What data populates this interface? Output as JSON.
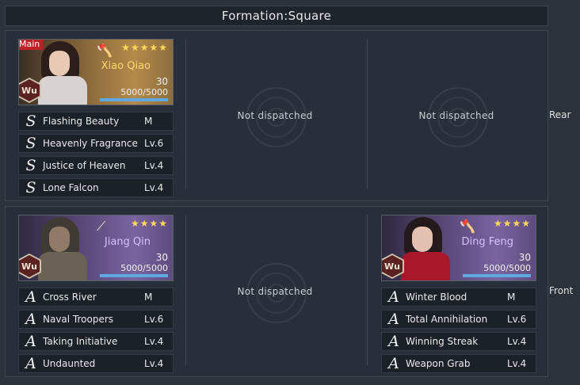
{
  "title": "Formation:Square",
  "rows": {
    "rear": {
      "label": "Rear"
    },
    "front": {
      "label": "Front"
    }
  },
  "empty_text": "Not dispatched",
  "generals": {
    "xiao_qiao": {
      "badge": "Main",
      "name": "Xiao Qiao",
      "faction": "Wu",
      "stars": "★★★★★",
      "level": "30",
      "troops": "5000/5000",
      "troop_fraction": 1.0,
      "weapon_icon": "axe-icon",
      "skills": [
        {
          "grade": "S",
          "name": "Flashing Beauty",
          "level": "M"
        },
        {
          "grade": "S",
          "name": "Heavenly Fragrance",
          "level": "Lv.6"
        },
        {
          "grade": "S",
          "name": "Justice of Heaven",
          "level": "Lv.4"
        },
        {
          "grade": "S",
          "name": "Lone Falcon",
          "level": "Lv.4"
        }
      ]
    },
    "jiang_qin": {
      "name": "Jiang Qin",
      "faction": "Wu",
      "stars": "★★★★",
      "level": "30",
      "troops": "5000/5000",
      "troop_fraction": 1.0,
      "weapon_icon": "spear-icon",
      "skills": [
        {
          "grade": "A",
          "name": "Cross River",
          "level": "M"
        },
        {
          "grade": "A",
          "name": "Naval Troopers",
          "level": "Lv.6"
        },
        {
          "grade": "A",
          "name": "Taking Initiative",
          "level": "Lv.4"
        },
        {
          "grade": "A",
          "name": "Undaunted",
          "level": "Lv.4"
        }
      ]
    },
    "ding_feng": {
      "name": "Ding Feng",
      "faction": "Wu",
      "stars": "★★★★",
      "level": "30",
      "troops": "5000/5000",
      "troop_fraction": 1.0,
      "weapon_icon": "axe-icon",
      "skills": [
        {
          "grade": "A",
          "name": "Winter Blood",
          "level": "M"
        },
        {
          "grade": "A",
          "name": "Total Annihilation",
          "level": "Lv.6"
        },
        {
          "grade": "A",
          "name": "Winning Streak",
          "level": "Lv.4"
        },
        {
          "grade": "A",
          "name": "Weapon Grab",
          "level": "Lv.4"
        }
      ]
    }
  }
}
